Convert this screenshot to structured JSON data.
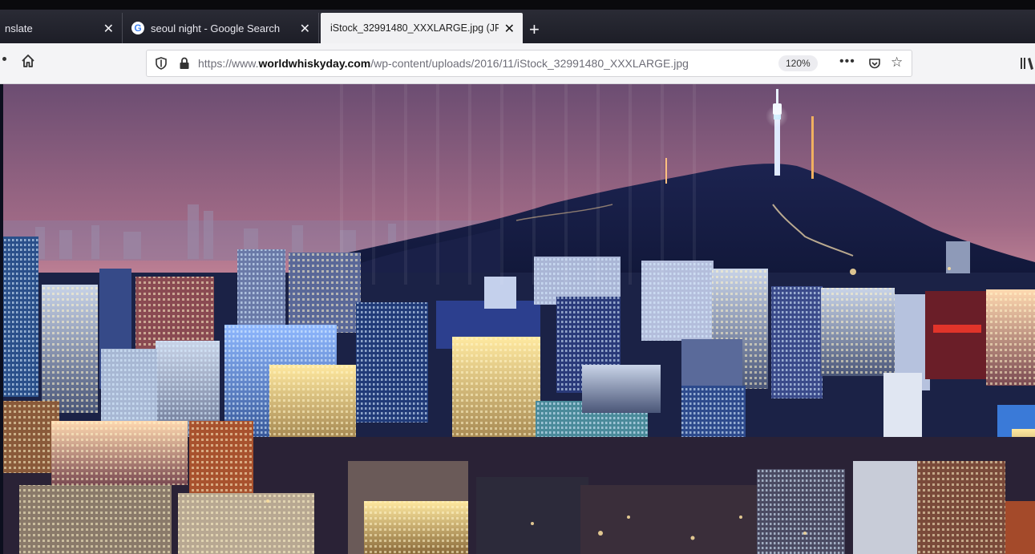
{
  "browser": {
    "tabs": [
      {
        "label": "nslate",
        "active": false
      },
      {
        "label": "seoul night - Google Search",
        "active": false,
        "icon": "google-icon"
      },
      {
        "label": "iStock_32991480_XXXLARGE.jpg (JP",
        "active": true
      }
    ],
    "new_tab_symbol": "+",
    "close_symbol": "✕",
    "google_glyph": "G"
  },
  "address_bar": {
    "url_prefix": "https://www.",
    "url_domain": "worldwhiskyday.com",
    "url_path": "/wp-content/uploads/2016/11/iStock_32991480_XXXLARGE.jpg",
    "zoom": "120%",
    "more_symbol": "•••",
    "star_symbol": "☆"
  },
  "content": {
    "image_subject": "night-city-skyline-with-tower-on-hill"
  },
  "colors": {
    "tab_bar": "#1f2029",
    "toolbar": "#f4f4f6",
    "sky_top": "#6c4d72",
    "sky_horizon": "#e7a0a8",
    "mountain": "#141a3e"
  }
}
